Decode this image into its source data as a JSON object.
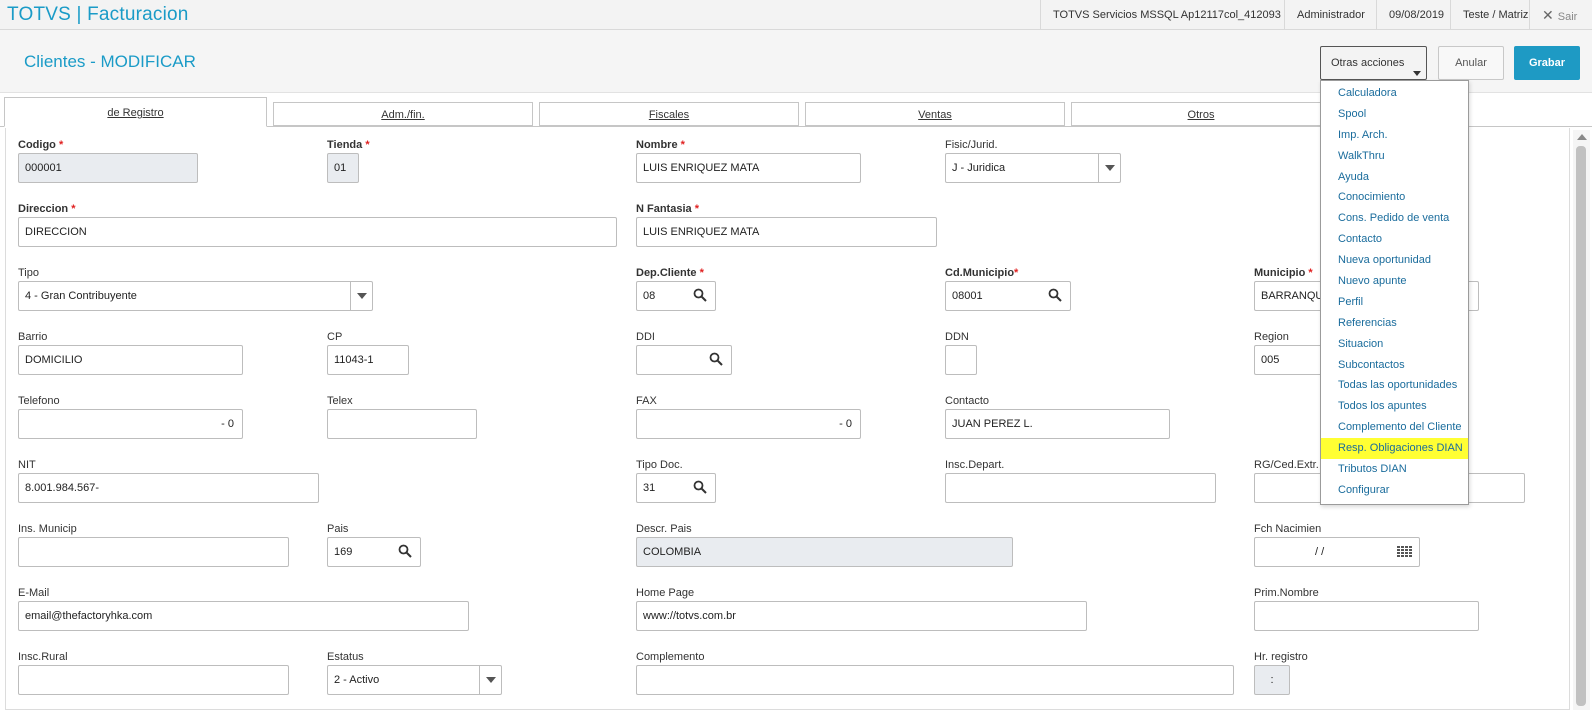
{
  "app": {
    "brand": "TOTVS | Facturacion"
  },
  "topbar": {
    "environment": "TOTVS Servicios MSSQL Ap12117col_412093",
    "user": "Administrador",
    "date": "09/08/2019",
    "branch": "Teste / Matriz",
    "exit_label": "Sair"
  },
  "header": {
    "title": "Clientes - MODIFICAR",
    "other_actions": "Otras acciones",
    "cancel": "Anular",
    "save": "Grabar"
  },
  "tabs": [
    {
      "label": "de Registro",
      "active": true
    },
    {
      "label": "Adm./fin."
    },
    {
      "label": "Fiscales"
    },
    {
      "label": "Ventas"
    },
    {
      "label": "Otros"
    }
  ],
  "menu": {
    "items": [
      "Calculadora",
      "Spool",
      "Imp. Arch.",
      "WalkThru",
      "Ayuda",
      "Conocimiento",
      "Cons. Pedido de venta",
      "Contacto",
      "Nueva oportunidad",
      "Nuevo apunte",
      "Perfil",
      "Referencias",
      "Situacion",
      "Subcontactos",
      "Todas las oportunidades",
      "Todos los apuntes",
      "Complemento del Cliente",
      "Resp. Obligaciones DIAN",
      "Tributos DIAN",
      "Configurar"
    ],
    "highlighted": "Resp. Obligaciones DIAN",
    "highlight_color": "#ffff33"
  },
  "form": {
    "codigo": {
      "label": "Codigo",
      "value": "000001"
    },
    "tienda": {
      "label": "Tienda",
      "value": "01"
    },
    "nombre": {
      "label": "Nombre",
      "value": "LUIS ENRIQUEZ MATA"
    },
    "fisic": {
      "label": "Fisic/Jurid.",
      "value": "J - Juridica"
    },
    "direccion": {
      "label": "Direccion",
      "value": "DIRECCION"
    },
    "fantasia": {
      "label": "N Fantasia",
      "value": "LUIS ENRIQUEZ MATA"
    },
    "tipo": {
      "label": "Tipo",
      "value": "4 - Gran Contribuyente"
    },
    "dep_cliente": {
      "label": "Dep.Cliente",
      "value": "08"
    },
    "cd_municipio": {
      "label": "Cd.Municipio",
      "value": "08001"
    },
    "municipio": {
      "label": "Municipio",
      "value": "BARRANQU"
    },
    "barrio": {
      "label": "Barrio",
      "value": "DOMICILIO"
    },
    "cp": {
      "label": "CP",
      "value": "11043-1"
    },
    "ddi": {
      "label": "DDI",
      "value": ""
    },
    "ddn": {
      "label": "DDN",
      "value": ""
    },
    "region": {
      "label": "Region",
      "value": "005"
    },
    "telefono": {
      "label": "Telefono",
      "value": "-  0"
    },
    "telex": {
      "label": "Telex",
      "value": ""
    },
    "fax": {
      "label": "FAX",
      "value": "-  0"
    },
    "contacto": {
      "label": "Contacto",
      "value": "JUAN PEREZ L."
    },
    "nit": {
      "label": "NIT",
      "value": "8.001.984.567-"
    },
    "tipo_doc": {
      "label": "Tipo Doc.",
      "value": "31"
    },
    "insc_depart": {
      "label": "Insc.Depart.",
      "value": ""
    },
    "rg_ced": {
      "label": "RG/Ced.Extr.",
      "value": ""
    },
    "ins_municip": {
      "label": "Ins. Municip",
      "value": ""
    },
    "pais": {
      "label": "Pais",
      "value": "169"
    },
    "descr_pais": {
      "label": "Descr. Pais",
      "value": "COLOMBIA"
    },
    "fch_nacimien": {
      "label": "Fch Nacimien",
      "value": "/  /"
    },
    "email": {
      "label": "E-Mail",
      "value": "email@thefactoryhka.com"
    },
    "home_page": {
      "label": "Home Page",
      "value": "www://totvs.com.br"
    },
    "prim_nombre": {
      "label": "Prim.Nombre",
      "value": ""
    },
    "insc_rural": {
      "label": "Insc.Rural",
      "value": ""
    },
    "estatus": {
      "label": "Estatus",
      "value": "2 - Activo"
    },
    "complemento": {
      "label": "Complemento",
      "value": ""
    },
    "hr_registro": {
      "label": "Hr. registro",
      "value": ":"
    }
  },
  "required_marker": "*"
}
